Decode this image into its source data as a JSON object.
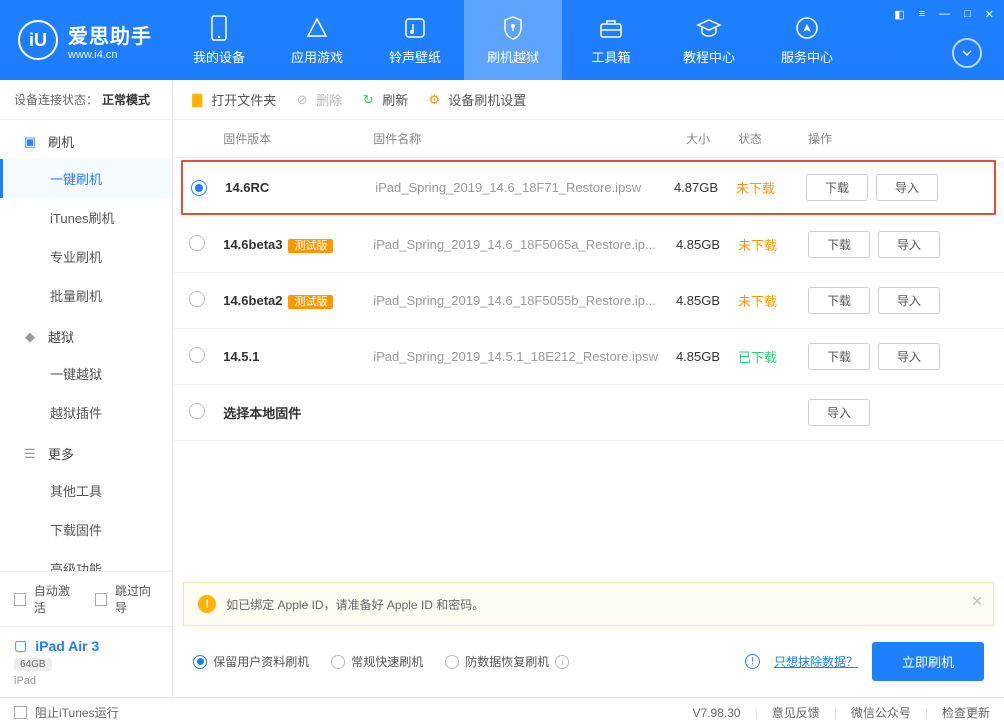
{
  "app": {
    "title": "爱思助手",
    "subtitle": "www.i4.cn"
  },
  "nav": [
    {
      "label": "我的设备"
    },
    {
      "label": "应用游戏"
    },
    {
      "label": "铃声壁纸"
    },
    {
      "label": "刷机越狱"
    },
    {
      "label": "工具箱"
    },
    {
      "label": "教程中心"
    },
    {
      "label": "服务中心"
    }
  ],
  "status": {
    "label": "设备连接状态：",
    "value": "正常模式"
  },
  "side": {
    "flash": {
      "title": "刷机",
      "items": [
        "一键刷机",
        "iTunes刷机",
        "专业刷机",
        "批量刷机"
      ]
    },
    "jailbreak": {
      "title": "越狱",
      "items": [
        "一键越狱",
        "越狱插件"
      ]
    },
    "more": {
      "title": "更多",
      "items": [
        "其他工具",
        "下载固件",
        "高级功能"
      ]
    }
  },
  "sb": {
    "auto_activate": "自动激活",
    "skip_guide": "跳过向导"
  },
  "device": {
    "name": "iPad Air 3",
    "capacity": "64GB",
    "type": "iPad"
  },
  "toolbar": {
    "open": "打开文件夹",
    "delete": "删除",
    "refresh": "刷新",
    "settings": "设备刷机设置"
  },
  "thead": {
    "version": "固件版本",
    "name": "固件名称",
    "size": "大小",
    "state": "状态",
    "action": "操作"
  },
  "rows": [
    {
      "version": "14.6RC",
      "badge": "",
      "name": "iPad_Spring_2019_14.6_18F71_Restore.ipsw",
      "size": "4.87GB",
      "state": "未下载",
      "stateClass": "st-orange",
      "selected": true,
      "highlight": true,
      "download": true,
      "import": true
    },
    {
      "version": "14.6beta3",
      "badge": "测试版",
      "name": "iPad_Spring_2019_14.6_18F5065a_Restore.ip...",
      "size": "4.85GB",
      "state": "未下载",
      "stateClass": "st-orange",
      "selected": false,
      "highlight": false,
      "download": true,
      "import": true
    },
    {
      "version": "14.6beta2",
      "badge": "测试版",
      "name": "iPad_Spring_2019_14.6_18F5055b_Restore.ip...",
      "size": "4.85GB",
      "state": "未下载",
      "stateClass": "st-orange",
      "selected": false,
      "highlight": false,
      "download": true,
      "import": true
    },
    {
      "version": "14.5.1",
      "badge": "",
      "name": "iPad_Spring_2019_14.5.1_18E212_Restore.ipsw",
      "size": "4.85GB",
      "state": "已下载",
      "stateClass": "st-green",
      "selected": false,
      "highlight": false,
      "download": true,
      "import": true
    },
    {
      "version": "选择本地固件",
      "badge": "",
      "name": "",
      "size": "",
      "state": "",
      "stateClass": "",
      "selected": false,
      "highlight": false,
      "download": false,
      "import": true
    }
  ],
  "btns": {
    "download": "下载",
    "import": "导入"
  },
  "banner": {
    "text": "如已绑定 Apple ID，请准备好 Apple ID 和密码。"
  },
  "opts": {
    "keep": "保留用户资料刷机",
    "quick": "常规快速刷机",
    "anti": "防数据恢复刷机",
    "erase_link": "只想抹除数据？",
    "primary": "立即刷机"
  },
  "footer": {
    "block_itunes": "阻止iTunes运行",
    "version": "V7.98.30",
    "feedback": "意见反馈",
    "wechat": "微信公众号",
    "update": "检查更新"
  }
}
